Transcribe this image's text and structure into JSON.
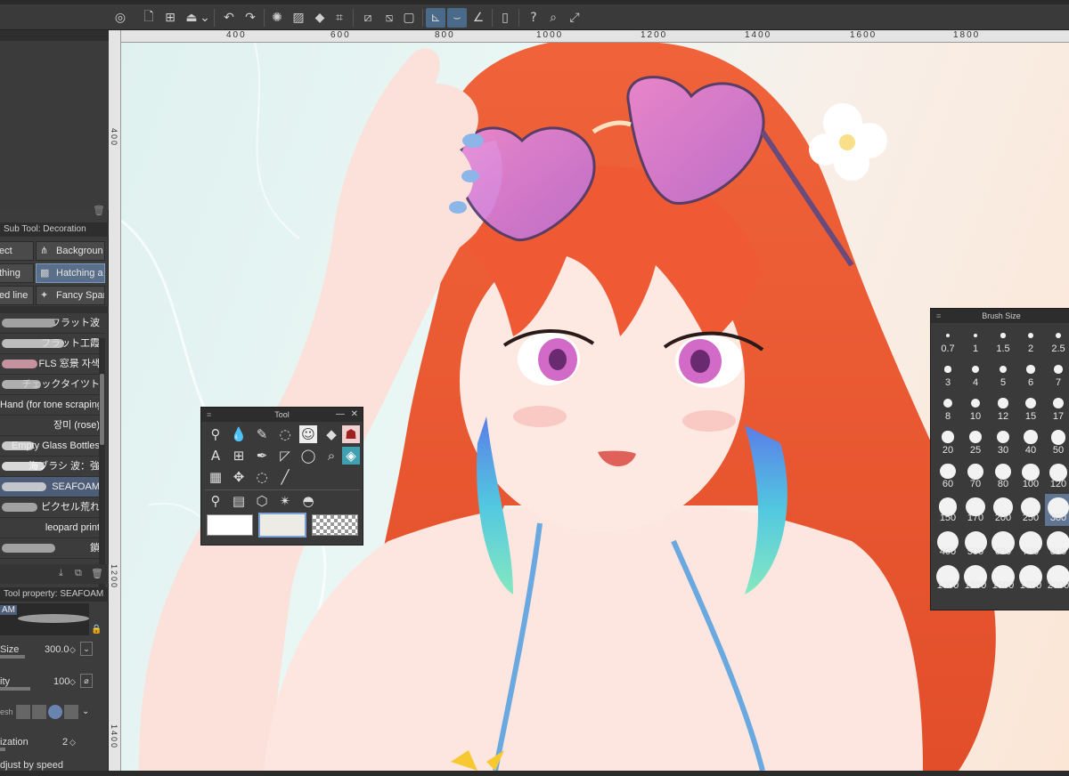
{
  "toolbar": {
    "icons": [
      "app-menu-icon",
      "new-icon",
      "add-icon",
      "save-icon",
      "dropdown-icon",
      "undo-icon",
      "redo-icon",
      "loading-icon",
      "fill-icon",
      "transform-icon",
      "crop-icon",
      "hide-icon",
      "layer-icon",
      "snap-ruler-icon",
      "snap-special-icon",
      "snap-grid-icon",
      "mobile-icon",
      "help-icon",
      "search-icon",
      "fullscreen-icon"
    ]
  },
  "ruler": {
    "h_ticks": [
      "400",
      "600",
      "800",
      "1000",
      "1200",
      "1400",
      "1600",
      "1800"
    ],
    "v_ticks": [
      "400",
      "1200",
      "1400"
    ]
  },
  "sub_tool": {
    "title": "Sub Tool: Decoration",
    "buttons": [
      {
        "label": "ect"
      },
      {
        "label": "Backgroun"
      },
      {
        "label": "thing"
      },
      {
        "label": "Hatching a"
      },
      {
        "label": "ed line"
      },
      {
        "label": "Fancy Spar"
      }
    ],
    "brushes": [
      {
        "label": "フラット波",
        "color": "#bbbbbb"
      },
      {
        "label": "フラット工霞",
        "color": "#dddddd"
      },
      {
        "label": "FLS 窓景 자색",
        "color": "#e8a8b8"
      },
      {
        "label": "チェックタイツト",
        "color": "#cccccc"
      },
      {
        "label": "Hand (for tone scraping)",
        "color": "#aaaaaa"
      },
      {
        "label": "장미 (rose)",
        "color": "#888888"
      },
      {
        "label": "Empty Glass Bottles",
        "color": "#eeeeee"
      },
      {
        "label": "海ブラシ 波：強",
        "color": "#ffffff"
      },
      {
        "label": "SEAFOAM",
        "color": "#e0e0e0"
      },
      {
        "label": "ピクセル荒れ",
        "color": "#bbbbbb"
      },
      {
        "label": "leopard print",
        "color": "#999999"
      },
      {
        "label": "鎖",
        "color": "#bbbbbb"
      }
    ]
  },
  "tool_property": {
    "title": "Tool property: SEAFOAM",
    "preview_label": "AM",
    "size_label": "Size",
    "size_value": "300.0",
    "opacity_label": "ity",
    "opacity_value": "100",
    "shape_label": "esh",
    "stab_label": "ization",
    "stab_value": "2",
    "speed_label": "djust by speed"
  },
  "tool_panel": {
    "title": "Tool",
    "icons": [
      "brush-settings-icon",
      "blend-icon",
      "pen-icon",
      "lasso-icon",
      "avatar-icon",
      "eraser-icon",
      "stamp-icon",
      "text-icon",
      "grid-icon",
      "eyedropper-icon",
      "gradient-icon",
      "balloon-icon",
      "zoom-icon",
      "fill-bucket-icon",
      "gradient-box-icon",
      "move-icon",
      "rotate-icon",
      "line-icon",
      "pin-icon",
      "frame-icon",
      "3d-cube-icon",
      "sparkle-icon",
      "vector-fill-icon"
    ],
    "colors": [
      "#ffffff",
      "#ecece4",
      "transparent"
    ]
  },
  "brush_size": {
    "title": "Brush Size",
    "sizes": [
      "0.7",
      "1",
      "1.5",
      "2",
      "2.5",
      "3",
      "4",
      "5",
      "6",
      "7",
      "8",
      "10",
      "12",
      "15",
      "17",
      "20",
      "25",
      "30",
      "40",
      "50",
      "60",
      "70",
      "80",
      "100",
      "120",
      "150",
      "170",
      "200",
      "250",
      "300",
      "400",
      "500",
      "600",
      "700",
      "800",
      "1000",
      "1200",
      "1500",
      "1700",
      "2000"
    ],
    "selected": "300"
  }
}
